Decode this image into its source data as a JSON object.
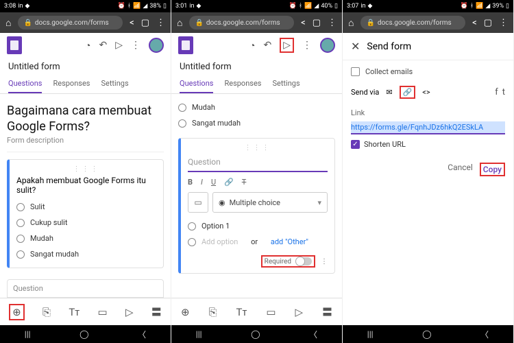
{
  "status": {
    "time1": "3:08",
    "time2": "3:01",
    "time3": "3:07",
    "batt1": "38%",
    "batt2": "40%",
    "batt3": "39%"
  },
  "url": "docs.google.com/forms",
  "formTitle": "Untitled form",
  "tabs": {
    "q": "Questions",
    "r": "Responses",
    "s": "Settings"
  },
  "p1": {
    "header": "Bagaimana cara membuat Google Forms?",
    "desc": "Form description",
    "question": "Apakah membuat Google Forms itu sulit?",
    "opts": [
      "Sulit",
      "Cukup sulit",
      "Mudah",
      "Sangat mudah"
    ],
    "newq": "Question"
  },
  "p2": {
    "opts": [
      "Mudah",
      "Sangat mudah"
    ],
    "qplaceholder": "Question",
    "type": "Multiple choice",
    "opt1": "Option 1",
    "addopt": "Add option",
    "or": "or",
    "addother": "add \"Other\"",
    "required": "Required"
  },
  "p3": {
    "sendform": "Send form",
    "collect": "Collect emails",
    "sendvia": "Send via",
    "linklabel": "Link",
    "link": "https://forms.gle/FqnhJDz6hkQ2ESkLA",
    "shorten": "Shorten URL",
    "cancel": "Cancel",
    "copy": "Copy"
  }
}
